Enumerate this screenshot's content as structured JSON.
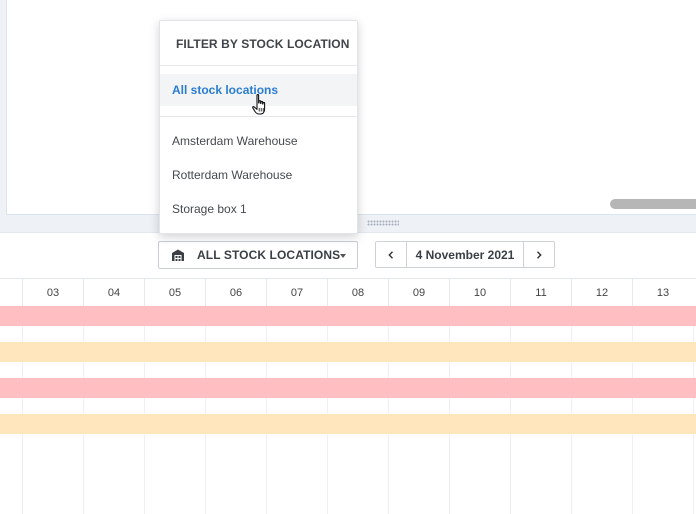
{
  "toolbar": {
    "location_select_label": "ALL STOCK LOCATIONS",
    "location_select_icon": "warehouse-icon",
    "prev_icon": "chevron-left-icon",
    "next_icon": "chevron-right-icon",
    "current_date": "4 November 2021"
  },
  "dropdown": {
    "header": "FILTER BY STOCK LOCATION",
    "items": [
      {
        "label": "All stock locations",
        "active": true
      },
      {
        "label": "Amsterdam Warehouse",
        "active": false
      },
      {
        "label": "Rotterdam Warehouse",
        "active": false
      },
      {
        "label": "Storage box 1",
        "active": false
      }
    ]
  },
  "timeline": {
    "days": [
      "03",
      "04",
      "05",
      "06",
      "07",
      "08",
      "09",
      "10",
      "11",
      "12",
      "13"
    ],
    "bars": [
      {
        "color": "#ffbfc2"
      },
      {
        "color": "#ffe6bd"
      },
      {
        "color": "#ffbfc2"
      },
      {
        "color": "#ffe6bd"
      }
    ]
  },
  "colors": {
    "accent": "#2a7dd1",
    "pink_bar": "#ffbfc2",
    "peach_bar": "#ffe6bd"
  }
}
